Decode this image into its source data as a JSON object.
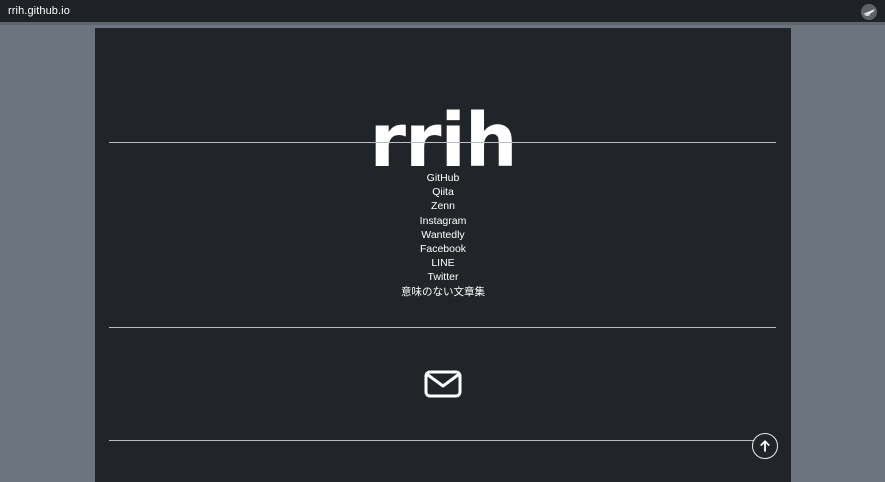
{
  "window": {
    "title": "rrih.github.io"
  },
  "site": {
    "title": "rrih"
  },
  "links": [
    {
      "label": "GitHub",
      "name": "link-github"
    },
    {
      "label": "Qiita",
      "name": "link-qiita"
    },
    {
      "label": "Zenn",
      "name": "link-zenn"
    },
    {
      "label": "Instagram",
      "name": "link-instagram"
    },
    {
      "label": "Wantedly",
      "name": "link-wantedly"
    },
    {
      "label": "Facebook",
      "name": "link-facebook"
    },
    {
      "label": "LINE",
      "name": "link-line"
    },
    {
      "label": "Twitter",
      "name": "link-twitter"
    },
    {
      "label": "意味のない文章集",
      "name": "link-meaningless-texts"
    }
  ],
  "icons": {
    "avatar": "avatar-icon",
    "mail": "envelope-icon",
    "scroll_top": "arrow-up-icon"
  },
  "colors": {
    "page_background": "#6c757d",
    "panel_background": "#212529",
    "topbar_background": "#1e2125",
    "text": "#ffffff",
    "divider": "#b9bdc2"
  }
}
